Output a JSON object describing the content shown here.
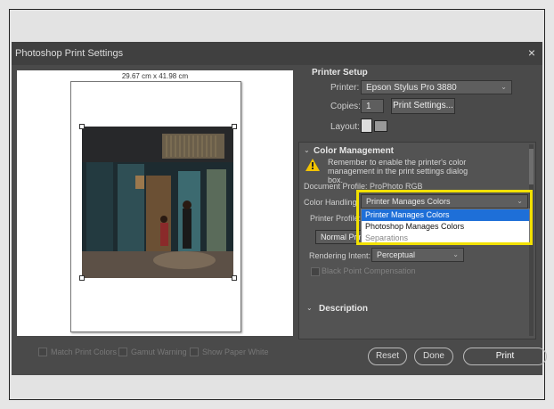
{
  "dialog": {
    "title": "Photoshop Print Settings",
    "close": "×"
  },
  "preview": {
    "dimensions": "29.67 cm x 41.98 cm"
  },
  "checkboxes": [
    {
      "label": "Match Print Colors"
    },
    {
      "label": "Gamut Warning"
    },
    {
      "label": "Show Paper White"
    }
  ],
  "printer_setup": {
    "title": "Printer Setup",
    "printer_label": "Printer:",
    "printer_value": "Epson Stylus Pro 3880",
    "copies_label": "Copies:",
    "copies_value": "1",
    "print_settings_button": "Print Settings...",
    "layout_label": "Layout:"
  },
  "color_management": {
    "title": "Color Management",
    "warning_text": "Remember to enable the printer's color management in the print settings dialog box.",
    "document_profile": "Document Profile: ProPhoto RGB",
    "color_handling_label": "Color Handling:",
    "color_handling_value": "Printer Manages Colors",
    "printer_profile_label": "Printer Profile:",
    "normal_print_button": "Normal Print",
    "rendering_intent_label": "Rendering Intent:",
    "rendering_intent_value": "Perceptual",
    "black_point_label": "Black Point Compensation",
    "dropdown_options": [
      "Printer Manages Colors",
      "Photoshop Manages Colors",
      "Separations"
    ]
  },
  "description": {
    "title": "Description"
  },
  "buttons": {
    "reset": "Reset",
    "done": "Done",
    "print": "Print"
  },
  "colors": {
    "dialog_bg": "#4a4a4a",
    "highlight": "#f2e100",
    "selection": "#1e6fd8"
  }
}
